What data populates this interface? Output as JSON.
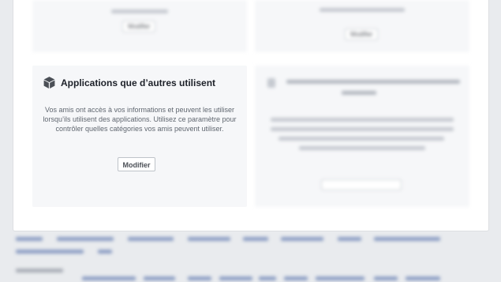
{
  "cards": {
    "top_left": {
      "button_label": "Modifier"
    },
    "top_right": {
      "button_label": "Modifier"
    },
    "apps_others_use": {
      "title": "Applications que d’autres utilisent",
      "description": "Vos amis ont accès à vos informations et peuvent les utiliser lorsqu’ils utilisent des applications. Utilisez ce paramètre pour contrôler quelles catégories vos amis peuvent utiliser.",
      "button_label": "Modifier",
      "icon": "box-icon"
    }
  },
  "colors": {
    "page_background": "#e9ebee",
    "card_background": "#f6f7f9",
    "link": "#365899"
  }
}
